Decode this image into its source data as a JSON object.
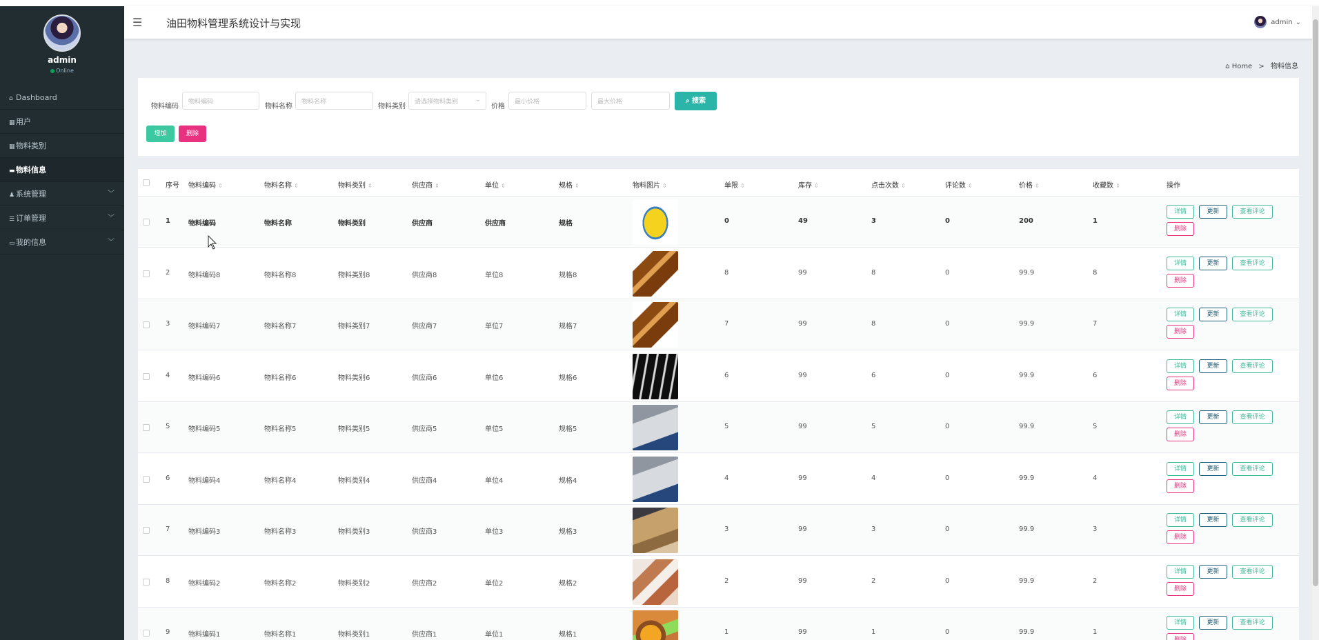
{
  "sidebar": {
    "user_name": "admin",
    "status": "Online",
    "items": [
      {
        "label": "Dashboard",
        "icon": "home-icon"
      },
      {
        "label": "用户",
        "icon": "grid-icon"
      },
      {
        "label": "物料类别",
        "icon": "grid-icon"
      },
      {
        "label": "物料信息",
        "icon": "card-icon"
      },
      {
        "label": "系统管理",
        "icon": "user-icon"
      },
      {
        "label": "订单管理",
        "icon": "list-icon"
      },
      {
        "label": "我的信息",
        "icon": "calendar-icon"
      }
    ]
  },
  "header": {
    "title": "油田物料管理系统设计与实现",
    "user": "admin"
  },
  "breadcrumb": {
    "home": "Home",
    "separator": ">",
    "current": "物料信息"
  },
  "search": {
    "code_label": "物料编码",
    "code_placeholder": "物料编码",
    "name_label": "物料名称",
    "name_placeholder": "物料名称",
    "category_label": "物料类别",
    "category_placeholder": "请选择物料类别",
    "price_label": "价格",
    "min_price_placeholder": "最小价格",
    "max_price_placeholder": "最大价格",
    "search_button": "搜索",
    "add_button": "增加",
    "delete_button": "删除"
  },
  "table": {
    "headers": {
      "index": "序号",
      "code": "物料编码",
      "name": "物料名称",
      "category": "物料类别",
      "supplier": "供应商",
      "unit": "单位",
      "spec": "规格",
      "image": "物料图片",
      "limit": "单限",
      "stock": "库存",
      "clicks": "点击次数",
      "comments": "评论数",
      "price": "价格",
      "favorites": "收藏数",
      "actions": "操作"
    },
    "action_labels": {
      "detail": "详情",
      "update": "更新",
      "review": "查看评论",
      "delete": "删除"
    },
    "rows": [
      {
        "index": "1",
        "code": "物料编码",
        "name": "物料名称",
        "category": "物料类别",
        "supplier": "供应商",
        "unit": "供应商",
        "spec": "规格",
        "limit": "0",
        "stock": "49",
        "clicks": "3",
        "comments": "0",
        "price": "200",
        "favorites": "1",
        "image": "rice-bag"
      },
      {
        "index": "2",
        "code": "物料编码8",
        "name": "物料名称8",
        "category": "物料类别8",
        "supplier": "供应商8",
        "unit": "单位8",
        "spec": "规格8",
        "limit": "8",
        "stock": "99",
        "clicks": "8",
        "comments": "0",
        "price": "99.9",
        "favorites": "8",
        "image": "brown-box"
      },
      {
        "index": "3",
        "code": "物料编码7",
        "name": "物料名称7",
        "category": "物料类别7",
        "supplier": "供应商7",
        "unit": "单位7",
        "spec": "规格7",
        "limit": "7",
        "stock": "99",
        "clicks": "8",
        "comments": "0",
        "price": "99.9",
        "favorites": "7",
        "image": "brown-box"
      },
      {
        "index": "4",
        "code": "物料编码6",
        "name": "物料名称6",
        "category": "物料类别6",
        "supplier": "供应商6",
        "unit": "单位6",
        "spec": "规格6",
        "limit": "6",
        "stock": "99",
        "clicks": "6",
        "comments": "0",
        "price": "99.9",
        "favorites": "6",
        "image": "white-tubes"
      },
      {
        "index": "5",
        "code": "物料编码5",
        "name": "物料名称5",
        "category": "物料类别5",
        "supplier": "供应商5",
        "unit": "单位5",
        "spec": "规格5",
        "limit": "5",
        "stock": "99",
        "clicks": "5",
        "comments": "0",
        "price": "99.9",
        "favorites": "5",
        "image": "cutlery"
      },
      {
        "index": "6",
        "code": "物料编码4",
        "name": "物料名称4",
        "category": "物料类别4",
        "supplier": "供应商4",
        "unit": "单位4",
        "spec": "规格4",
        "limit": "4",
        "stock": "99",
        "clicks": "4",
        "comments": "0",
        "price": "99.9",
        "favorites": "4",
        "image": "cutlery"
      },
      {
        "index": "7",
        "code": "物料编码3",
        "name": "物料名称3",
        "category": "物料类别3",
        "supplier": "供应商3",
        "unit": "单位3",
        "spec": "规格3",
        "limit": "3",
        "stock": "99",
        "clicks": "3",
        "comments": "0",
        "price": "99.9",
        "favorites": "3",
        "image": "paper-bags"
      },
      {
        "index": "8",
        "code": "物料编码2",
        "name": "物料名称2",
        "category": "物料类别2",
        "supplier": "供应商2",
        "unit": "单位2",
        "spec": "规格2",
        "limit": "2",
        "stock": "99",
        "clicks": "2",
        "comments": "0",
        "price": "99.9",
        "favorites": "2",
        "image": "food-items"
      },
      {
        "index": "9",
        "code": "物料编码1",
        "name": "物料名称1",
        "category": "物料类别1",
        "supplier": "供应商1",
        "unit": "单位1",
        "spec": "规格1",
        "limit": "1",
        "stock": "99",
        "clicks": "1",
        "comments": "0",
        "price": "99.9",
        "favorites": "1",
        "image": "food-bowl"
      }
    ]
  }
}
